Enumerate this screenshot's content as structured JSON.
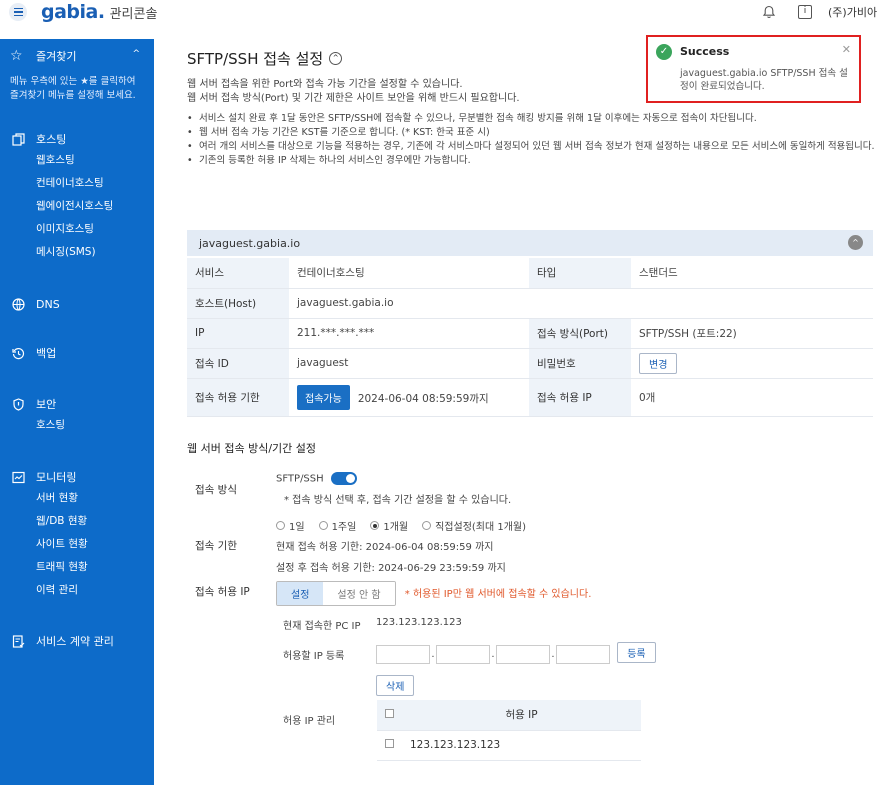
{
  "topbar": {
    "logo": "gabia.",
    "console_title": "관리콘솔",
    "company": "(주)가비아"
  },
  "sidebar": {
    "favorites_label": "즐겨찾기",
    "favorites_desc": "메뉴 우측에 있는 ★를 클릭하여 즐겨찾기 메뉴를 설정해 보세요.",
    "hosting": {
      "label": "호스팅",
      "items": [
        "웹호스팅",
        "컨테이너호스팅",
        "웹에이전시호스팅",
        "이미지호스팅",
        "메시징(SMS)"
      ]
    },
    "dns": "DNS",
    "backup": "백업",
    "security": {
      "label": "보안",
      "items": [
        "호스팅"
      ]
    },
    "monitoring": {
      "label": "모니터링",
      "items": [
        "서버 현황",
        "웹/DB 현황",
        "사이트 현황",
        "트래픽 현황",
        "이력 관리"
      ]
    },
    "contract": "서비스 계약 관리"
  },
  "page": {
    "title": "SFTP/SSH 접속 설정",
    "intro1": "웹 서버 접속을 위한 Port와 접속 가능 기간을 설정할 수 있습니다.",
    "intro2": "웹 서버 접속 방식(Port) 및 기간 제한은 사이트 보안을 위해 반드시 필요합니다.",
    "bullets": [
      "서비스 설치 완료 후 1달 동안은 SFTP/SSH에 접속할 수 있으나, 무분별한 접속 해킹 방지를 위해 1달 이후에는 자동으로 접속이 차단됩니다.",
      "웹 서버 접속 가능 기간은 KST를 기준으로 합니다. (* KST: 한국 표준 시)",
      "여러 개의 서비스를 대상으로 기능을 적용하는 경우, 기존에 각 서비스마다 설정되어 있던 웹 서버 접속 정보가 현재 설정하는 내용으로 모든 서비스에 동일하게 적용됩니다.",
      "기존의 등록한 허용 IP 삭제는 하나의 서비스인 경우에만 가능합니다."
    ]
  },
  "service": {
    "header": "javaguest.gabia.io",
    "service_key": "서비스",
    "service_val": "컨테이너호스팅",
    "type_key": "타입",
    "type_val": "스탠더드",
    "host_key": "호스트(Host)",
    "host_val": "javaguest.gabia.io",
    "ip_key": "IP",
    "ip_val": "211.***.***.***",
    "port_key": "접속 방식(Port)",
    "port_val": "SFTP/SSH (포트:22)",
    "id_key": "접속 ID",
    "id_val": "javaguest",
    "pw_key": "비밀번호",
    "pw_button": "변경",
    "limit_key": "접속 허용 기한",
    "limit_button": "접속가능",
    "limit_val": "2024-06-04 08:59:59까지",
    "allowip_key": "접속 허용 IP",
    "allowip_val": "0개"
  },
  "settings": {
    "title": "웹 서버 접속 방식/기간 설정",
    "method_label": "접속 방식",
    "method_value": "SFTP/SSH",
    "method_note": "* 접속 방식 선택 후, 접속 기간 설정을 할 수 있습니다.",
    "period_label": "접속 기한",
    "period_options": [
      "1일",
      "1주일",
      "1개월",
      "직접설정(최대 1개월)"
    ],
    "period_selected": "1개월",
    "current_limit": "현재 접속 허용 기한: 2024-06-04 08:59:59 까지",
    "after_limit": "설정 후 접속 허용 기한: 2024-06-29 23:59:59 까지",
    "ip_label": "접속 허용 IP",
    "ip_set": "설정",
    "ip_unset": "설정 안 함",
    "ip_warning": "* 허용된 IP만 웹 서버에 접속할 수 있습니다.",
    "current_pc_label": "현재 접속한 PC IP",
    "current_pc_ip": "123.123.123.123",
    "register_label": "허용할 IP 등록",
    "register_button": "등록",
    "delete_button": "삭제",
    "manage_label": "허용 IP 관리",
    "table_header": "허용 IP",
    "allowed_ips": [
      "123.123.123.123"
    ]
  },
  "toast": {
    "title": "Success",
    "message": "javaguest.gabia.io SFTP/SSH 접속 설정이 완료되었습니다.",
    "border_color": "#e02020",
    "icon_color": "#3ba55c"
  },
  "colors": {
    "sidebar": "#0d6bc9",
    "accent": "#1a6fc4",
    "warning": "#e0582b"
  }
}
